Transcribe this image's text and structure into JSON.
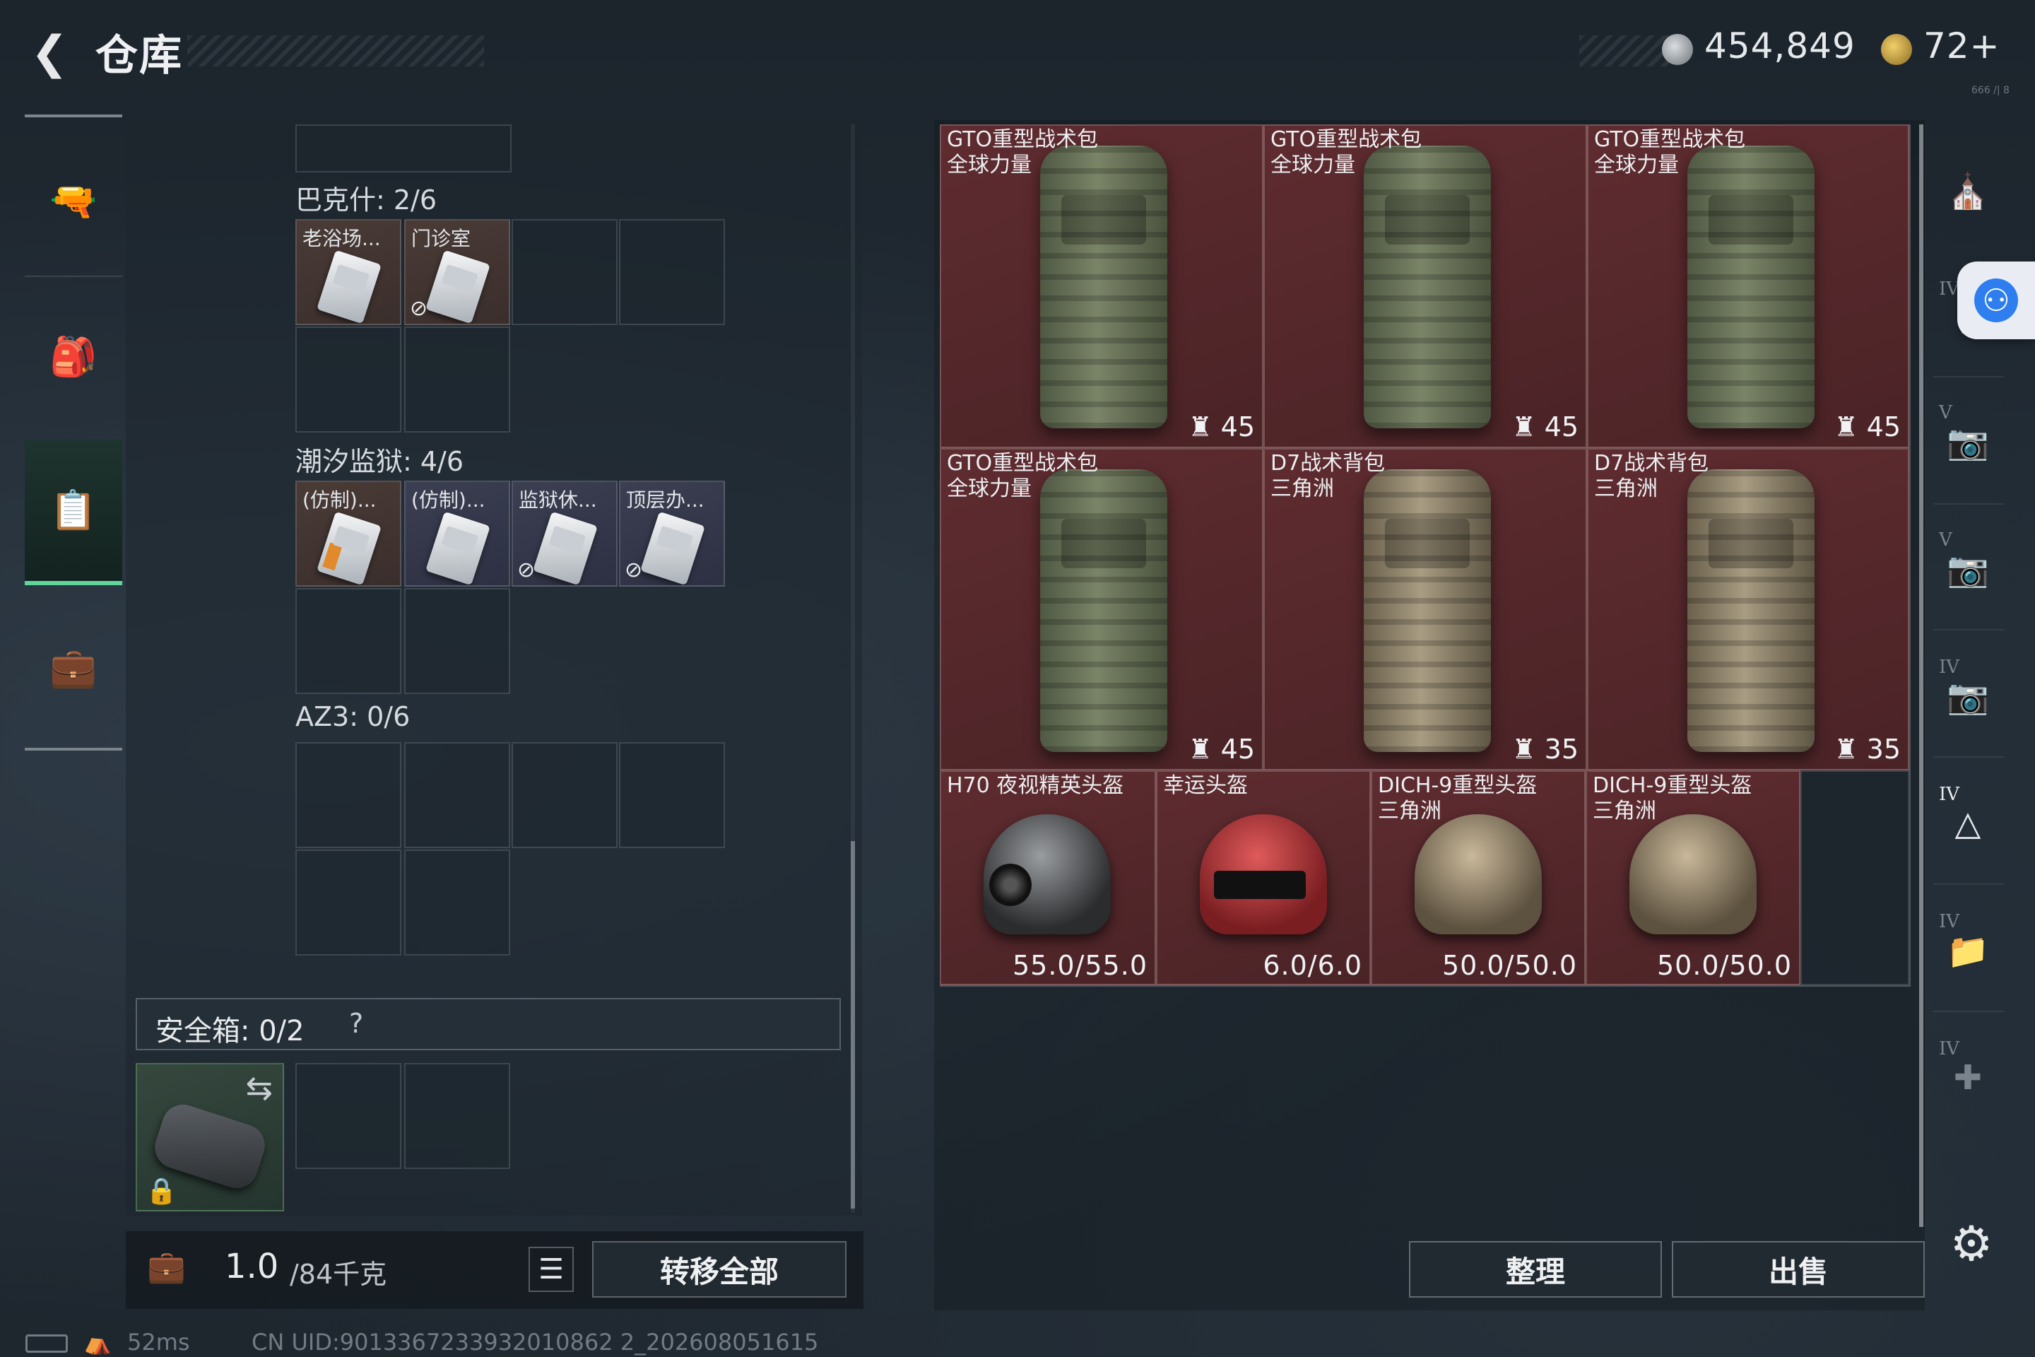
{
  "header": {
    "back_icon": "chevron-left-icon",
    "title": "仓库",
    "currency_silver": "454,849",
    "currency_gold": "72+",
    "version_small": "666 /| 8"
  },
  "left_rail": {
    "items": [
      {
        "name": "weapons",
        "icon": "rifle-icon"
      },
      {
        "name": "equipment",
        "icon": "backpack-icon"
      },
      {
        "name": "containers",
        "icon": "clipboard-icon",
        "active": true
      },
      {
        "name": "supplies",
        "icon": "briefcase-icon"
      }
    ]
  },
  "containers": [
    {
      "label": "巴克什: 2/6",
      "items": [
        {
          "label": "老浴场...",
          "type": "keycard"
        },
        {
          "label": "门诊室",
          "type": "keycard",
          "no_copy": true
        }
      ]
    },
    {
      "label": "潮汐监狱: 4/6",
      "items": [
        {
          "label": "(仿制)...",
          "type": "keycard",
          "orange": true
        },
        {
          "label": "(仿制)...",
          "type": "keycard"
        },
        {
          "label": "监狱休...",
          "type": "keycard",
          "no_copy": true
        },
        {
          "label": "顶层办...",
          "type": "keycard",
          "no_copy": true
        }
      ]
    },
    {
      "label": "AZ3: 0/6",
      "items": []
    }
  ],
  "safe_box": {
    "label": "安全箱: 0/2",
    "help": "?",
    "swap_icon": "swap-icon",
    "lock_icon": "lock-icon"
  },
  "bottom_left": {
    "weight_value": "1.0",
    "weight_capacity": "/84千克",
    "weight_icon": "weight-icon",
    "list_icon": "list-icon",
    "transfer_all": "转移全部"
  },
  "status_bar": {
    "ping": "52ms",
    "uid": "CN UID:9013367233932010862 2_202608051615"
  },
  "warehouse": {
    "items": [
      {
        "name_line1": "GTO重型战术包",
        "name_line2": "全球力量",
        "value": "45",
        "kind": "pack"
      },
      {
        "name_line1": "GTO重型战术包",
        "name_line2": "全球力量",
        "value": "45",
        "kind": "pack"
      },
      {
        "name_line1": "GTO重型战术包",
        "name_line2": "全球力量",
        "value": "45",
        "kind": "pack"
      },
      {
        "name_line1": "GTO重型战术包",
        "name_line2": "全球力量",
        "value": "45",
        "kind": "pack"
      },
      {
        "name_line1": "D7战术背包",
        "name_line2": "三角洲",
        "value": "35",
        "kind": "pack-tan"
      },
      {
        "name_line1": "D7战术背包",
        "name_line2": "三角洲",
        "value": "35",
        "kind": "pack-tan"
      },
      {
        "name_line1": "H70 夜视精英头盔",
        "name_line2": "",
        "value": "55.0/55.0",
        "kind": "helmet-nvg"
      },
      {
        "name_line1": "幸运头盔",
        "name_line2": "",
        "value": "6.0/6.0",
        "kind": "helmet-red"
      },
      {
        "name_line1": "DICH-9重型头盔",
        "name_line2": "三角洲",
        "value": "50.0/50.0",
        "kind": "helmet-tan"
      },
      {
        "name_line1": "DICH-9重型头盔",
        "name_line2": "三角洲",
        "value": "50.0/50.0",
        "kind": "helmet-tan"
      }
    ],
    "sort_button": "整理",
    "sell_button": "出售"
  },
  "right_rail": {
    "filters": [
      {
        "icon": "helmet-filter-icon",
        "tier": ""
      },
      {
        "icon": "armor-filter-icon",
        "tier": "IV"
      },
      {
        "icon": "keycard-filter-icon",
        "tier": "V"
      },
      {
        "icon": "keycard-filter-icon",
        "tier": "V"
      },
      {
        "icon": "keycard-filter-icon",
        "tier": "IV"
      },
      {
        "icon": "triangle-keycard-filter-icon",
        "tier": "IV",
        "active": true
      },
      {
        "icon": "folder-filter-icon",
        "tier": "IV"
      },
      {
        "icon": "medical-filter-icon",
        "tier": "IV"
      }
    ],
    "accessibility_icon": "accessibility-icon",
    "settings_icon": "gear-icon"
  },
  "colors": {
    "active_accent": "#5fd79a",
    "item_bg": "#5a2a2e",
    "accessibility_blue": "#2f7ef0"
  }
}
